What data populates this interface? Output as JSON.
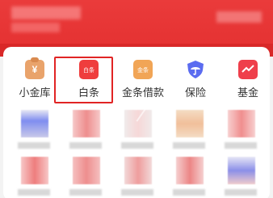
{
  "nav": {
    "items": [
      {
        "label": "小金库",
        "icon": "money-bag-icon"
      },
      {
        "label": "白条",
        "icon": "baitiao-icon",
        "icon_text": "白条",
        "highlighted": true
      },
      {
        "label": "金条借款",
        "icon": "jintiao-icon",
        "icon_text": "金条"
      },
      {
        "label": "保险",
        "icon": "umbrella-shield-icon"
      },
      {
        "label": "基金",
        "icon": "fund-chart-icon"
      }
    ]
  },
  "colors": {
    "brand_red": "#e43030",
    "highlight": "#e12424",
    "bag": "#e9a36b",
    "baitiao": "#ef3d3d",
    "jintiao": "#f1a556",
    "insurance": "#5b6cf0",
    "fund": "#ef3f4b"
  }
}
